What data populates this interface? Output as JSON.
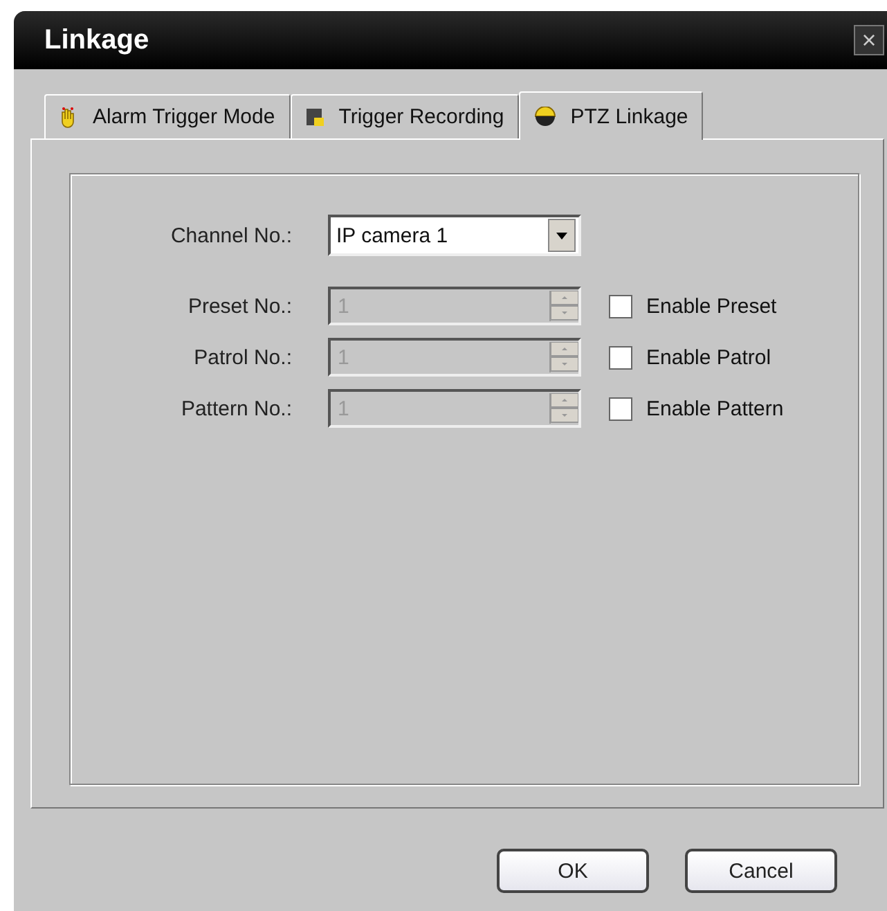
{
  "window": {
    "title": "Linkage",
    "close": "×"
  },
  "tabs": [
    {
      "label": "Alarm Trigger Mode",
      "kind": "alarm",
      "selected": false
    },
    {
      "label": "Trigger Recording",
      "kind": "recording",
      "selected": false
    },
    {
      "label": "PTZ Linkage",
      "kind": "ptz",
      "selected": true
    }
  ],
  "fields": [
    {
      "kind": "dropdown",
      "label": "Channel No.:",
      "value": "IP camera 1",
      "disabled": false
    },
    {
      "kind": "spinner",
      "label": "Preset No.:",
      "value": "1",
      "disabled": true,
      "checkbox": {
        "label": "Enable Preset",
        "checked": false
      }
    },
    {
      "kind": "spinner",
      "label": "Patrol No.:",
      "value": "1",
      "disabled": true,
      "checkbox": {
        "label": "Enable Patrol",
        "checked": false
      }
    },
    {
      "kind": "spinner",
      "label": "Pattern No.:",
      "value": "1",
      "disabled": true,
      "checkbox": {
        "label": "Enable Pattern",
        "checked": false
      }
    }
  ],
  "buttons": [
    "OK",
    "Cancel"
  ]
}
